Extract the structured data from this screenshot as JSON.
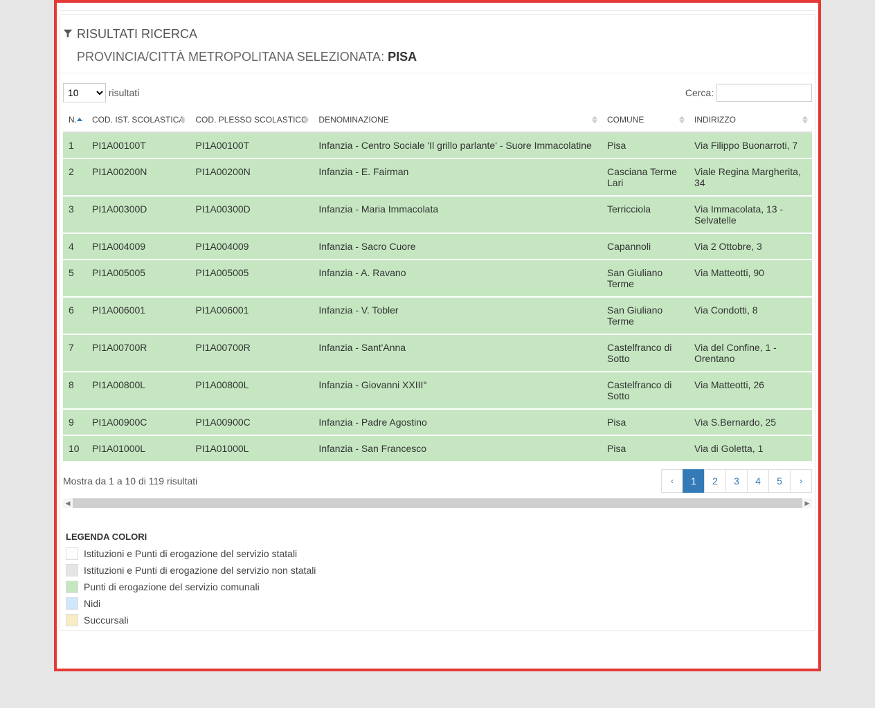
{
  "header": {
    "title": "RISULTATI RICERCA",
    "subtitle_prefix": "PROVINCIA/CITTÀ METROPOLITANA SELEZIONATA:",
    "province": "PISA"
  },
  "controls": {
    "page_size_value": "10",
    "page_size_suffix": "risultati",
    "search_label": "Cerca:",
    "search_value": ""
  },
  "table": {
    "columns": {
      "n": "N.",
      "cod_ist": "COD. IST. SCOLASTICA",
      "cod_plesso": "COD. PLESSO SCOLASTICO",
      "denominazione": "DENOMINAZIONE",
      "comune": "COMUNE",
      "indirizzo": "INDIRIZZO"
    },
    "rows": [
      {
        "n": "1",
        "cod_ist": "PI1A00100T",
        "cod_plesso": "PI1A00100T",
        "den": "Infanzia - Centro Sociale 'Il grillo parlante' - Suore Immacolatine",
        "comune": "Pisa",
        "indirizzo": "Via Filippo Buonarroti, 7"
      },
      {
        "n": "2",
        "cod_ist": "PI1A00200N",
        "cod_plesso": "PI1A00200N",
        "den": "Infanzia - E. Fairman",
        "comune": "Casciana Terme Lari",
        "indirizzo": "Viale Regina Margherita, 34"
      },
      {
        "n": "3",
        "cod_ist": "PI1A00300D",
        "cod_plesso": "PI1A00300D",
        "den": "Infanzia - Maria Immacolata",
        "comune": "Terricciola",
        "indirizzo": "Via Immacolata, 13 - Selvatelle"
      },
      {
        "n": "4",
        "cod_ist": "PI1A004009",
        "cod_plesso": "PI1A004009",
        "den": "Infanzia - Sacro Cuore",
        "comune": "Capannoli",
        "indirizzo": "Via 2 Ottobre, 3"
      },
      {
        "n": "5",
        "cod_ist": "PI1A005005",
        "cod_plesso": "PI1A005005",
        "den": "Infanzia - A. Ravano",
        "comune": "San Giuliano Terme",
        "indirizzo": "Via Matteotti, 90"
      },
      {
        "n": "6",
        "cod_ist": "PI1A006001",
        "cod_plesso": "PI1A006001",
        "den": "Infanzia - V. Tobler",
        "comune": "San Giuliano Terme",
        "indirizzo": "Via Condotti, 8"
      },
      {
        "n": "7",
        "cod_ist": "PI1A00700R",
        "cod_plesso": "PI1A00700R",
        "den": "Infanzia - Sant'Anna",
        "comune": "Castelfranco di Sotto",
        "indirizzo": "Via del Confine, 1 - Orentano"
      },
      {
        "n": "8",
        "cod_ist": "PI1A00800L",
        "cod_plesso": "PI1A00800L",
        "den": "Infanzia - Giovanni XXIII°",
        "comune": "Castelfranco di Sotto",
        "indirizzo": "Via Matteotti, 26"
      },
      {
        "n": "9",
        "cod_ist": "PI1A00900C",
        "cod_plesso": "PI1A00900C",
        "den": "Infanzia - Padre Agostino",
        "comune": "Pisa",
        "indirizzo": "Via S.Bernardo, 25"
      },
      {
        "n": "10",
        "cod_ist": "PI1A01000L",
        "cod_plesso": "PI1A01000L",
        "den": "Infanzia - San Francesco",
        "comune": "Pisa",
        "indirizzo": "Via di Goletta, 1"
      }
    ]
  },
  "footer": {
    "info": "Mostra da 1 a 10 di 119 risultati",
    "pages": [
      "1",
      "2",
      "3",
      "4",
      "5"
    ],
    "active_page": "1",
    "prev": "‹",
    "next": "›"
  },
  "legend": {
    "title": "LEGENDA COLORI",
    "items": [
      {
        "color": "#ffffff",
        "label": "Istituzioni e Punti di erogazione del servizio statali"
      },
      {
        "color": "#e5e5e5",
        "label": "Istituzioni e Punti di erogazione del servizio non statali"
      },
      {
        "color": "#c5e6c1",
        "label": "Punti di erogazione del servizio comunali"
      },
      {
        "color": "#cfe6fb",
        "label": "Nidi"
      },
      {
        "color": "#f7ecc4",
        "label": "Succursali"
      }
    ]
  }
}
